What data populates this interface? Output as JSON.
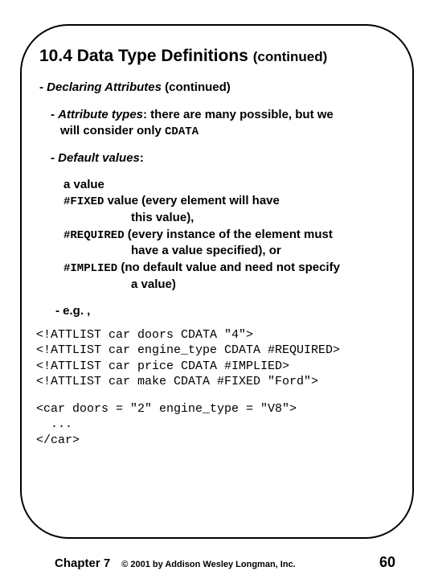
{
  "title": {
    "main": "10.4 Data Type Definitions",
    "continued": "(continued)"
  },
  "sub1": {
    "dash": "- ",
    "label": "Declaring Attributes",
    "continued": " (continued)"
  },
  "attr_types": {
    "dash": "- ",
    "label": "Attribute types",
    "text1": ": there are many possible, but we",
    "text2": "will consider only ",
    "token": "CDATA"
  },
  "defvals": {
    "dash": "- ",
    "label": "Default values",
    "colon": ":"
  },
  "values": {
    "l1": "a value",
    "l2a": "#FIXED",
    "l2b": " value (every element will have",
    "l2c": "this value),",
    "l3a": "#REQUIRED",
    "l3b": " (every instance of the element must",
    "l3c": "have a value specified), or",
    "l4a": "#IMPLIED",
    "l4b": " (no default value and need not specify",
    "l4c": "a value)"
  },
  "eg": "- e.g. ,",
  "code1": "<!ATTLIST car doors CDATA \"4\">\n<!ATTLIST car engine_type CDATA #REQUIRED>\n<!ATTLIST car price CDATA #IMPLIED>\n<!ATTLIST car make CDATA #FIXED \"Ford\">",
  "code2": "<car doors = \"2\" engine_type = \"V8\">\n  ...\n</car>",
  "footer": {
    "chapter": "Chapter 7",
    "copyright": "© 2001 by Addison Wesley Longman, Inc.",
    "page": "60"
  }
}
